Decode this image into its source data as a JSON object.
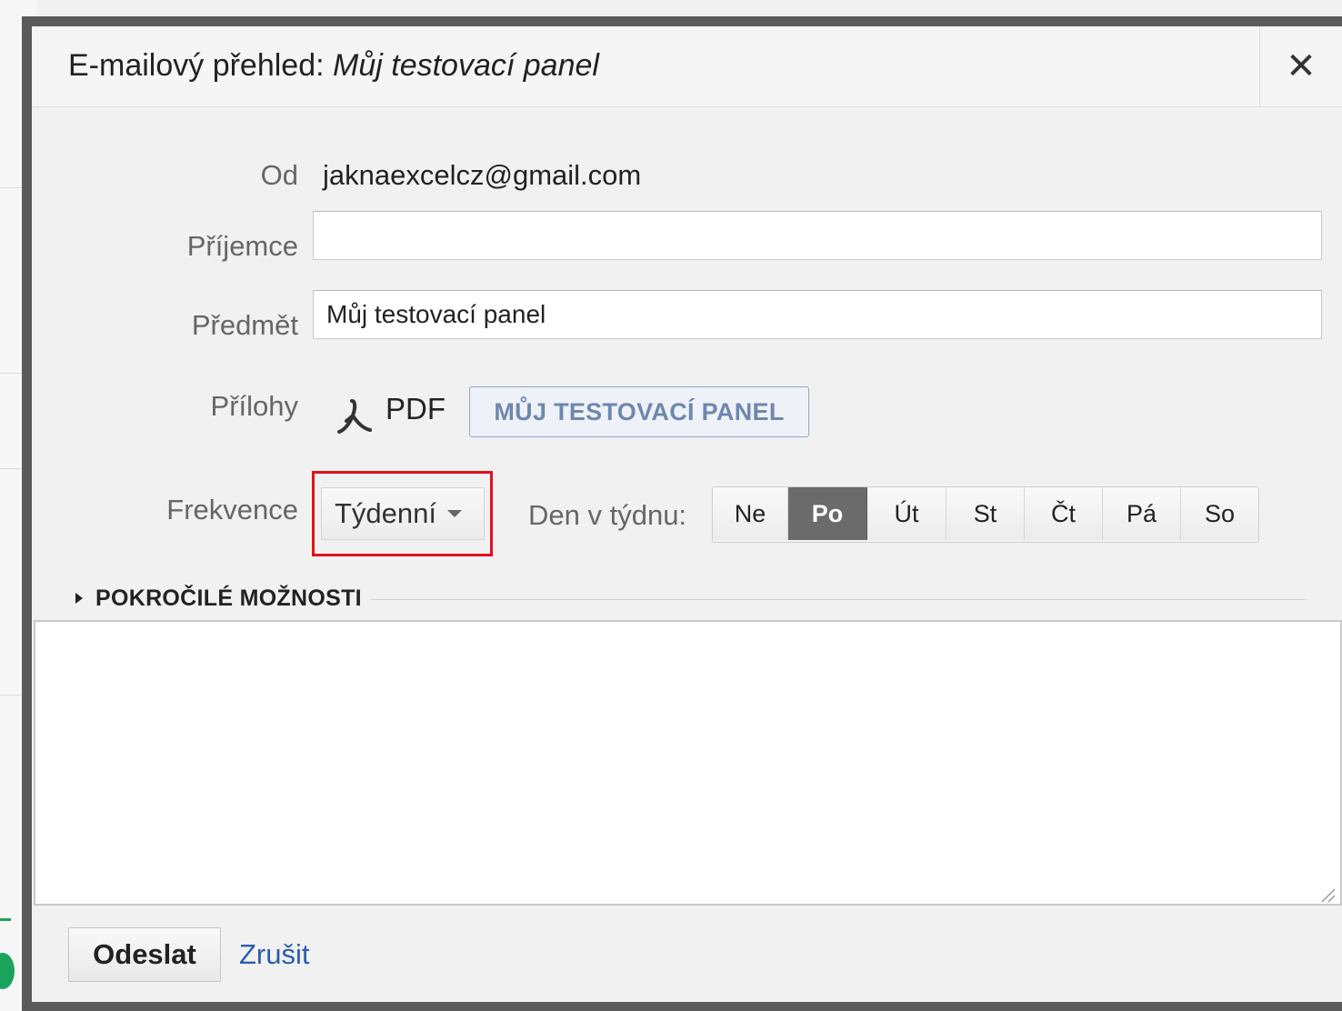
{
  "dialog": {
    "title_prefix": "E-mailový přehled:",
    "title_name": "Můj testovací panel",
    "close_symbol": "✕"
  },
  "form": {
    "from_label": "Od",
    "from_value": "jaknaexcelcz@gmail.com",
    "recipients_label": "Příjemce",
    "recipients_value": "",
    "subject_label": "Předmět",
    "subject_value": "Můj testovací panel",
    "attachments_label": "Přílohy",
    "attachment_format": "PDF",
    "attachment_name": "MŮJ TESTOVACÍ PANEL",
    "frequency_label": "Frekvence",
    "frequency_value": "Týdenní",
    "weekday_label": "Den v týdnu:",
    "weekdays": [
      {
        "label": "Ne",
        "selected": false
      },
      {
        "label": "Po",
        "selected": true
      },
      {
        "label": "Út",
        "selected": false
      },
      {
        "label": "St",
        "selected": false
      },
      {
        "label": "Čt",
        "selected": false
      },
      {
        "label": "Pá",
        "selected": false
      },
      {
        "label": "So",
        "selected": false
      }
    ],
    "advanced_label": "POKROČILÉ MOŽNOSTI",
    "message_value": ""
  },
  "footer": {
    "send_label": "Odeslat",
    "cancel_label": "Zrušit"
  },
  "colors": {
    "highlight": "#e0121b",
    "selected_day": "#6b6b6b",
    "link": "#2a5db0",
    "chip_text": "#6f87ad"
  }
}
